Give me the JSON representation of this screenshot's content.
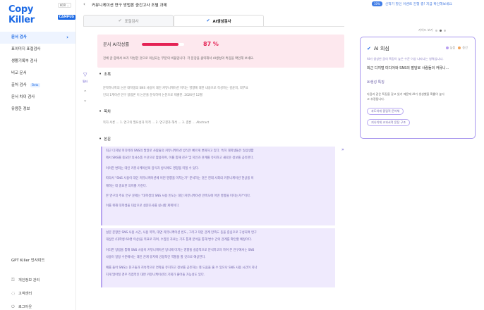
{
  "sidebar": {
    "logo_text": "Copy Killer",
    "logo_badge": "CAMPUS",
    "lang": "KOR ⌄",
    "items": [
      {
        "label": "문서 검사",
        "active": true
      },
      {
        "label": "표이미지 표절검사"
      },
      {
        "label": "생활기록부 검사"
      },
      {
        "label": "비교 문서"
      },
      {
        "label": "출처 검사",
        "badge": "Beta"
      },
      {
        "label": "문서 차이 검사"
      },
      {
        "label": "유용한 정보"
      }
    ],
    "gpt_label": "GPT Killer 인사이드",
    "footer": [
      {
        "label": "개인정보 관리"
      },
      {
        "label": "고객센터"
      },
      {
        "label": "로그아웃"
      }
    ]
  },
  "header": {
    "title": "커뮤니케이션 연구 방법론 중간고사 조별 과제",
    "promo_tag": "10%",
    "promo_text": "신학기 할인 이벤트 진행 중! 지금 확인해보세요"
  },
  "tabs": [
    {
      "label": "표절검사",
      "active": false
    },
    {
      "label": "AI생성검사",
      "active": true
    }
  ],
  "score": {
    "label": "문서 AI작성률",
    "percent_text": "87 %",
    "percent": 87,
    "description": "전체 글 중에서 AI가 작성한 것으로 의심되는 부분의 비율입니다. 각 문장을 클릭해서 AI생성의 특징을 확인해 보세요."
  },
  "tools": {
    "filter_label": "필터"
  },
  "sections": {
    "abstract": {
      "title": "초록",
      "text": [
        "문학하나학의 논문 대학생의 SNS 사용이 대인 커뮤니케이션 미치는 영향에 대한 내용으로 작성하는 김윤희, 외부요",
        "인의 1케이션 연구 방법론 이 논문을 분석하여 논문으로 제출한. 2026년 12월"
      ]
    },
    "toc": {
      "title": "목차",
      "text": [
        "목차 서론 ... 1. 연구의 필요성과 목적 ... 2. 연구결과 해석 ... 3. 결론 ... Abstract"
      ]
    },
    "body": {
      "title": "본문",
      "ai_block_1": [
        "최근 디지털 미디어와 SNS의 발달로 사람들의 커뮤니케이션 방식은 빠르게 변화하고 있다. 특히 대학생들은 일상생활",
        "에서 SNS를 중요한 의사소통 수단으로 활용하며, 이를 통해 친구 및 지인과 관계를 유지하고 새로운 정보를 공유한다.",
        "",
        "이러한 변화는 대인 커뮤니케이션의 양식과 방식에도 영향을 미칠 수 있다.",
        "",
        "따라서 \"SNS 사용이 대인 커뮤니케이션에 어떤 영향을 미치는가\" 분석하는 것은 현대 사회의 커뮤니케이션 현상을 이",
        "해하는 데 중요한 의미를 가진다.",
        "",
        "본 연구의 주요 연구 문제는 \"대학생의 SNS 사용 빈도는 대인 커뮤니케이션 만족도에 어떤 영향을 미치는가?\"이다.",
        "",
        "이를 위해 대학생을 대상으로 설문조사를 실시할 계획이다."
      ],
      "ai_block_2": [
        "설문 문항은 SNS 사용 시간, 사용 목적, 대면 커뮤니케이션 빈도, 그리고 대인 관계 만족도 등을 중심으로 구성되며 연구",
        "대상은 (대학생 60명 이상)을 목표로 하며, 수집된 자료는 기초 통계 분석을 통해 변수 간의 관계를 확인할 예정이다.",
        "",
        "이러한 방법을 통해 SNS 사용이 커뮤니케이션 방식에 미치는 영향을 실증적으로 분석하고자 하며 본 연구에서는 SNS",
        "사용이 일정 수준에서는 대인 관계 유지에 긍정적인 역할을 할 것으로 예상한다.",
        "",
        "예를 들어 SNS는 친구들과 지속적으로 연락을 유지하고 정보를 공유하는 데 도움을 줄 수 있으나 SNS 사용 시간이 지나",
        "치게 많아질 경우 직접적인 대면 커뮤니케이션의 기회가 줄어들 가능성도 있다."
      ]
    }
  },
  "right_panel": {
    "tools_label": "가이드 보기",
    "card": {
      "title": "AI 의심",
      "status_labels": [
        "높음",
        "중간"
      ],
      "status_colors": [
        "#b79df0",
        "#f2a35a"
      ],
      "desc": "AI가 생성한 글의 특징이 높은 수준 이상 나타나는 영역입니다.",
      "selected_text": "최근 디지털 미디어와 SNS의 발달로 사람들의 커뮤니...",
      "sub_title": "AI생성 특징",
      "reason": "다음과 같은 특징을 갖고 있기 때문에 AI가 생성했을 확률이 높다",
      "reason2": "고 추정됩니다.",
      "chips": [
        "과도하게 중립적 문어체",
        "지나치게 교과서적 문장 구조"
      ]
    }
  },
  "colors": {
    "brand": "#1d6ae5",
    "score_accent": "#e42355",
    "ai_highlight": "#efeafd"
  }
}
